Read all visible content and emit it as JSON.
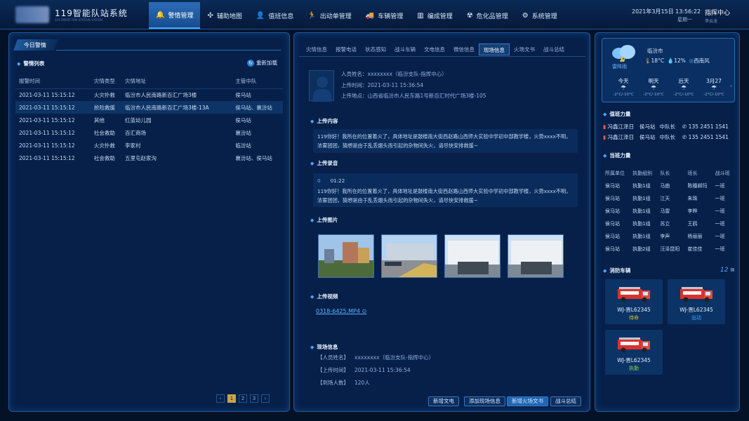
{
  "app": {
    "title": "119智能队站系统",
    "subtitle": "119 SMART FIRE STATION SYSTEM"
  },
  "nav": [
    {
      "label": "警情管理",
      "icon": "bell-icon",
      "glyph": "🔔",
      "active": true
    },
    {
      "label": "辅助地图",
      "icon": "map-icon",
      "glyph": "✣"
    },
    {
      "label": "值班信息",
      "icon": "person-icon",
      "glyph": "👤"
    },
    {
      "label": "出动单管理",
      "icon": "running-icon",
      "glyph": "🏃"
    },
    {
      "label": "车辆管理",
      "icon": "truck-icon",
      "glyph": "🚚"
    },
    {
      "label": "编成管理",
      "icon": "building-icon",
      "glyph": "▥"
    },
    {
      "label": "危化品管理",
      "icon": "hazard-icon",
      "glyph": "☢"
    },
    {
      "label": "系统管理",
      "icon": "gear-icon",
      "glyph": "⚙"
    }
  ],
  "header": {
    "datetime": "2021年3月15日  13:56:22",
    "weekday": "星期一",
    "user": "指挥中心",
    "user_sub": "李云龙"
  },
  "left": {
    "tab": "今日警情",
    "list_title": "警情列表",
    "reload": "重新加载",
    "columns": [
      "报警时间",
      "灾情类型",
      "灾情地址",
      "主管中队"
    ],
    "rows": [
      [
        "2021-03-11 15:15:12",
        "火灾扑救",
        "临汾市人民南路新百汇广场3楼",
        "侯马站"
      ],
      [
        "2021-03-11 15:15:12",
        "抢险救援",
        "临汾市人民南路新百汇广场3楼-13A",
        "侯马站、襄汾站"
      ],
      [
        "2021-03-11 15:15:12",
        "其他",
        "红蓝幼儿园",
        "侯马站"
      ],
      [
        "2021-03-11 15:15:12",
        "社会救助",
        "百汇商场",
        "襄汾站"
      ],
      [
        "2021-03-11 15:15:12",
        "火灾扑救",
        "李家村",
        "临汾站"
      ],
      [
        "2021-03-11 15:15:12",
        "社会救助",
        "五里屯赵家沟",
        "襄汾站、侯马站"
      ]
    ],
    "pager": {
      "prev": "‹",
      "pages": [
        "1",
        "2",
        "3"
      ],
      "next": "›"
    }
  },
  "mid": {
    "tabs": [
      "灾情信息",
      "报警电话",
      "状态感知",
      "战斗车辆",
      "文电信息",
      "微信信息",
      "现场信息",
      "火场文书",
      "战斗总结"
    ],
    "active_tab": 6,
    "person_label": "人员姓名：",
    "person": "xxxxxxxx（临汾支队-指挥中心）",
    "upload_time_label": "上传时间：",
    "upload_time": "2021-03-11  15:36:54",
    "location_label": "上传地点：",
    "location": "山西省临汾市人民东路1号新百汇时代广场3楼-105",
    "content_title": "上传内容",
    "content": "119你好！我所在的位置着火了，具体地址是鼓楼南大街西赵路山西师大实验中学初中部教学楼，火势xxxx不明，浓雾团团，猜想是由于乱丢烟头而引起的杂物间失火，请尽快安排救援~",
    "audio_title": "上传录音",
    "audio_index": "0",
    "audio_duration": "01:22",
    "audio_text": "119你好！我所在的位置着火了，具体地址是鼓楼南大街西赵路山西师大实验中学初中部教学楼，火势xxxx不明，浓雾团团，猜想是由于乱丢烟头而引起的杂物间失火，请尽快安排救援~",
    "images_title": "上传图片",
    "video_title": "上传视频",
    "video_file": "0318-6425.MP4",
    "scene_title": "现场信息",
    "scene": [
      {
        "label": "【人员姓名】",
        "value": "xxxxxxxx（临汾支队-指挥中心）"
      },
      {
        "label": "【上传时间】",
        "value": "2021-03-11  15:36:54"
      },
      {
        "label": "【到场人数】",
        "value": "120人"
      }
    ],
    "buttons": [
      "新增文电",
      "添加现场信息",
      "新增火场文书",
      "战斗总结"
    ]
  },
  "right": {
    "weather": {
      "city": "临汾市",
      "label": "雷阵雨",
      "temp": "18°C",
      "humidity": "12%",
      "wind": "西南风",
      "forecast": [
        {
          "day": "今天",
          "temp": "-2°C/-10°C"
        },
        {
          "day": "明天",
          "temp": "-2°C/-10°C"
        },
        {
          "day": "后天",
          "temp": "-2°C/-10°C"
        },
        {
          "day": "3月27",
          "temp": "-2°C/-10°C"
        }
      ]
    },
    "duty_title": "值班力量",
    "duty": [
      {
        "name": "冯鑫江泽日",
        "station": "侯马站",
        "role": "中队长",
        "phone": "135 2451 1541"
      },
      {
        "name": "冯鑫江泽日",
        "station": "侯马站",
        "role": "中队长",
        "phone": "135 2451 1541"
      }
    ],
    "shift_title": "当班力量",
    "shift_columns": [
      "所属单位",
      "执勤组别",
      "队长",
      "班长",
      "战斗班"
    ],
    "shift_rows": [
      [
        "侯马站",
        "执勤1组",
        "马曲",
        "陈檀郸玛",
        "一班"
      ],
      [
        "侯马站",
        "执勤1组",
        "江天",
        "朱珠",
        "一班"
      ],
      [
        "侯马站",
        "执勤1组",
        "马雷",
        "李晔",
        "一班"
      ],
      [
        "侯马站",
        "执勤1组",
        "苏立",
        "王鸥",
        "一班"
      ],
      [
        "侯马站",
        "执勤1组",
        "李声",
        "杨丽丽",
        "一班"
      ],
      [
        "侯马站",
        "执勤2组",
        "汪泽昆阳",
        "崔佳佳",
        "一班"
      ]
    ],
    "trucks_title": "消防车辆",
    "trucks_count": "12",
    "trucks_unit": "辆",
    "trucks": [
      {
        "name": "WJ-晋L62345",
        "status": "待命",
        "color": "#e2c13c"
      },
      {
        "name": "WJ-晋L62345",
        "status": "出动",
        "color": "#3ea8ff"
      },
      {
        "name": "WJ-晋L62345",
        "status": "执勤",
        "color": "#8fd14f"
      }
    ]
  }
}
